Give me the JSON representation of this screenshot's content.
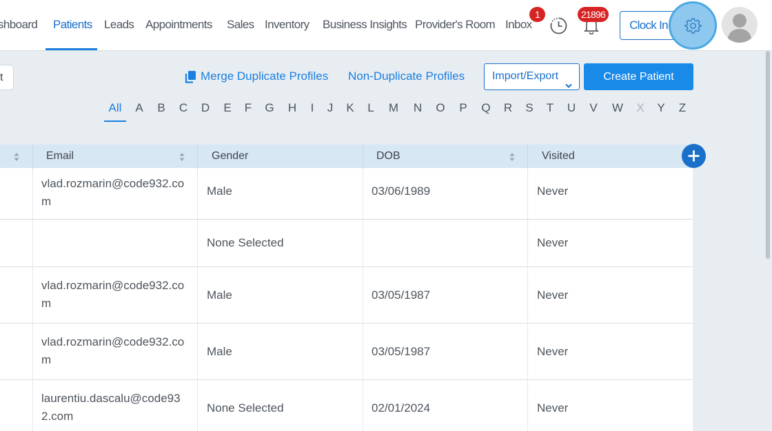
{
  "nav": {
    "items": [
      {
        "label": "shboard",
        "active": false
      },
      {
        "label": "Patients",
        "active": true
      },
      {
        "label": "Leads",
        "active": false
      },
      {
        "label": "Appointments",
        "active": false
      },
      {
        "label": "Sales",
        "active": false
      },
      {
        "label": "Inventory",
        "active": false
      },
      {
        "label": "Business Insights",
        "active": false
      },
      {
        "label": "Provider's Room",
        "active": false
      },
      {
        "label": "Inbox",
        "active": false
      }
    ],
    "inbox_badge": "1",
    "notification_badge": "21896",
    "clock_in_label": "Clock In",
    "icons": [
      "clock-history-icon",
      "bell-icon",
      "gear-icon",
      "user-avatar-icon"
    ]
  },
  "toolbar": {
    "left_button_label": "t",
    "merge_label": "Merge Duplicate Profiles",
    "non_duplicate_label": "Non-Duplicate Profiles",
    "import_export_label": "Import/Export",
    "create_patient_label": "Create Patient"
  },
  "alphabet": {
    "letters": [
      "All",
      "A",
      "B",
      "C",
      "D",
      "E",
      "F",
      "G",
      "H",
      "I",
      "J",
      "K",
      "L",
      "M",
      "N",
      "O",
      "P",
      "Q",
      "R",
      "S",
      "T",
      "U",
      "V",
      "W",
      "X",
      "Y",
      "Z"
    ],
    "active": "All",
    "disabled": [
      "X"
    ]
  },
  "table": {
    "columns": [
      {
        "label": "",
        "sortable": true
      },
      {
        "label": "Email",
        "sortable": true
      },
      {
        "label": "Gender",
        "sortable": false
      },
      {
        "label": "DOB",
        "sortable": true
      },
      {
        "label": "Visited",
        "sortable": false
      }
    ],
    "rows": [
      {
        "email": "vlad.rozmarin@code932.com",
        "gender": "Male",
        "dob": "03/06/1989",
        "visited": "Never"
      },
      {
        "email": "",
        "gender": "None Selected",
        "dob": "",
        "visited": "Never"
      },
      {
        "email": "vlad.rozmarin@code932.com",
        "gender": "Male",
        "dob": "03/05/1987",
        "visited": "Never"
      },
      {
        "email": "vlad.rozmarin@code932.com",
        "gender": "Male",
        "dob": "03/05/1987",
        "visited": "Never"
      },
      {
        "email": "laurentiu.dascalu@code932.com",
        "gender": "None Selected",
        "dob": "02/01/2024",
        "visited": "Never"
      }
    ]
  },
  "colors": {
    "accent": "#1a7fe0",
    "badge": "#d62424",
    "header_bg": "#d7e7f4",
    "page_bg": "#e8edf2"
  }
}
